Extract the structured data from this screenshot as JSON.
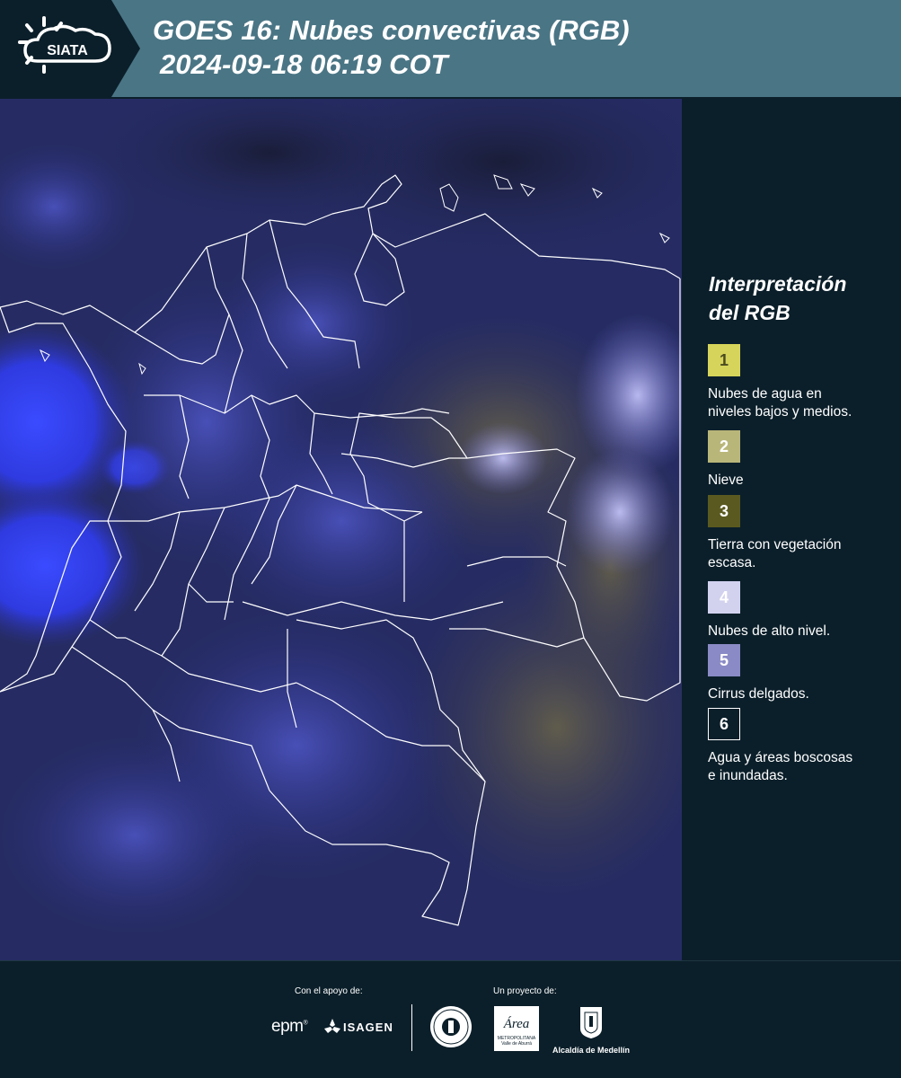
{
  "header": {
    "brand": "SIATA",
    "title_line1": "GOES 16: Nubes convectivas (RGB)",
    "title_line2": "2024-09-18 06:19 COT"
  },
  "legend": {
    "title_line1": "Interpretación",
    "title_line2": "del RGB",
    "items": [
      {
        "number": "1",
        "color": "#d6d45a",
        "text_color": "#4a4a20",
        "line1": "Nubes de agua en",
        "line2": "niveles bajos y medios."
      },
      {
        "number": "2",
        "color": "#b9b67a",
        "text_color": "#ffffff",
        "line1": "Nieve",
        "line2": ""
      },
      {
        "number": "3",
        "color": "#5a5a20",
        "text_color": "#ffffff",
        "line1": "Tierra con vegetación",
        "line2": "escasa."
      },
      {
        "number": "4",
        "color": "#d2d2ef",
        "text_color": "#ffffff",
        "line1": "Nubes de alto nivel.",
        "line2": ""
      },
      {
        "number": "5",
        "color": "#8a8ac6",
        "text_color": "#ffffff",
        "line1": "Cirrus delgados.",
        "line2": ""
      },
      {
        "number": "6",
        "color": "#0b1f2a",
        "text_color": "#ffffff",
        "line1": "Agua y áreas boscosas",
        "line2": "e inundadas."
      }
    ]
  },
  "footer": {
    "support_label": "Con el apoyo de:",
    "project_label": "Un proyecto de:",
    "logos": {
      "epm": "epm",
      "isagen": "ISAGEN",
      "area_metro": "Área",
      "area_metro_sub1": "METROPOLITANA",
      "area_metro_sub2": "Valle de Aburrá",
      "alcaldia": "Alcaldía de Medellín"
    }
  },
  "colors": {
    "header_bg": "#4a7585",
    "panel_bg": "#0b1f2a",
    "map_base": "#232a5e",
    "cloud_blue": "#2f3aff"
  }
}
